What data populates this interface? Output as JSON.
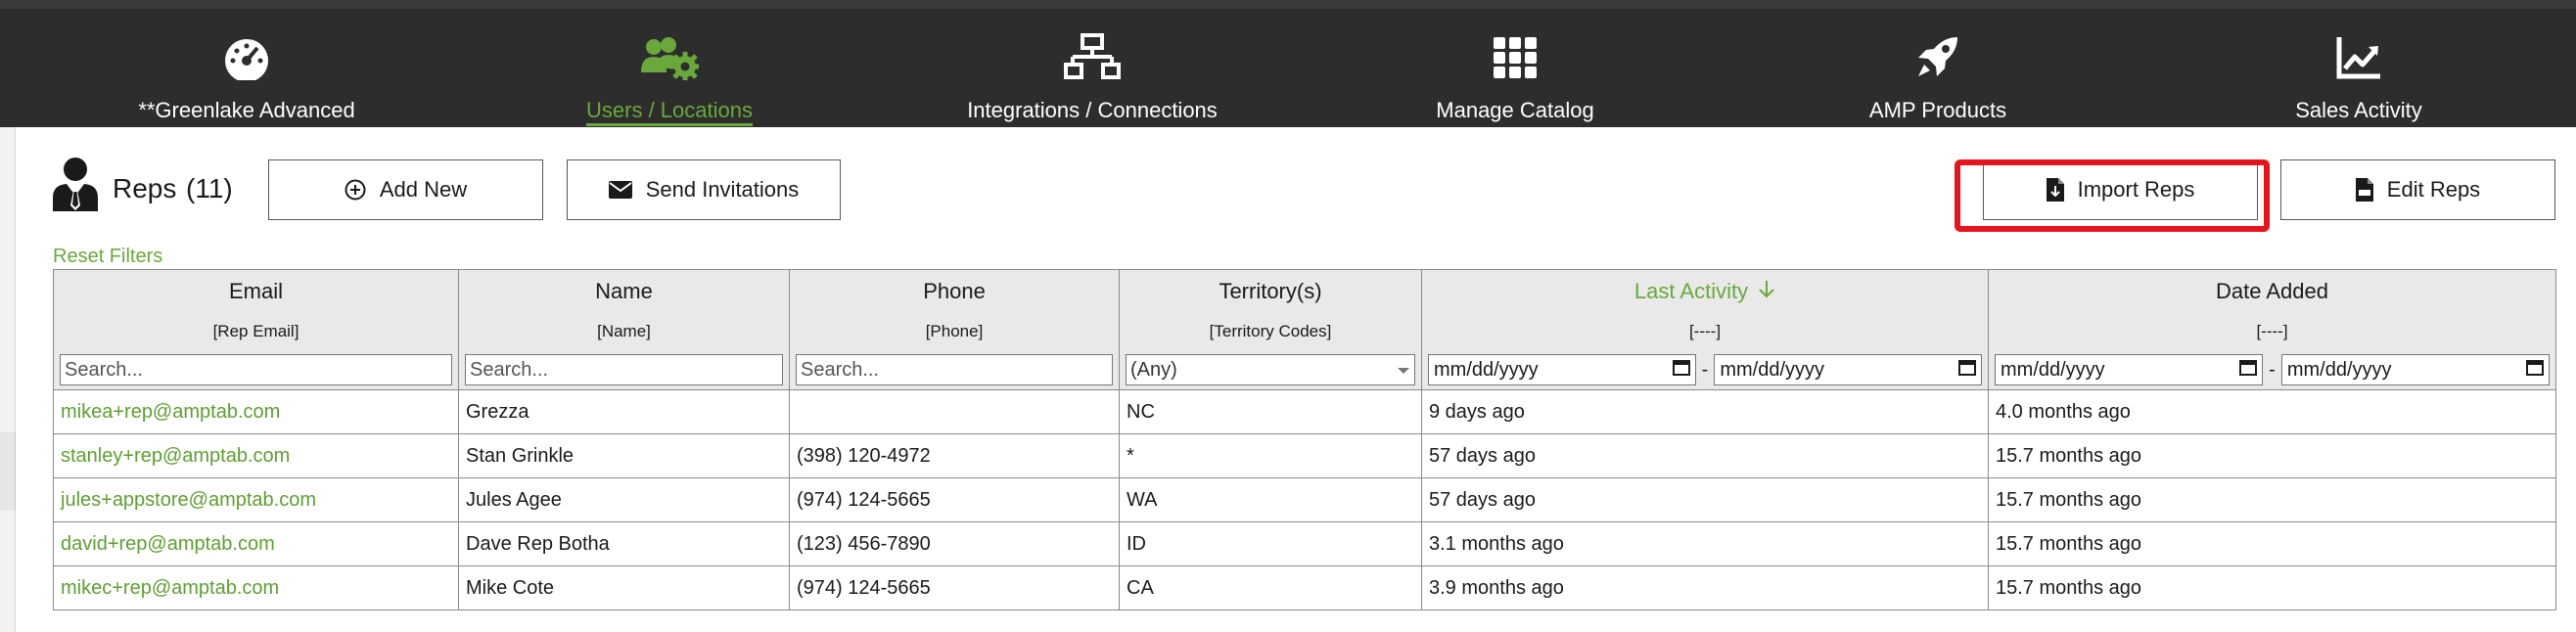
{
  "nav": {
    "items": [
      {
        "label": "**Greenlake Advanced",
        "icon": "dashboard-gauge-icon"
      },
      {
        "label": "Users / Locations",
        "icon": "users-gear-icon",
        "active": true
      },
      {
        "label": "Integrations / Connections",
        "icon": "network-icon"
      },
      {
        "label": "Manage Catalog",
        "icon": "grid-icon"
      },
      {
        "label": "AMP Products",
        "icon": "rocket-icon"
      },
      {
        "label": "Sales Activity",
        "icon": "chart-line-icon"
      }
    ],
    "active_color": "#6aa83b",
    "background": "#2d2d2d"
  },
  "header": {
    "title": "Reps",
    "count": "(11)",
    "add_new": "Add New",
    "send_invitations": "Send Invitations",
    "import_reps": "Import Reps",
    "edit_reps": "Edit Reps",
    "highlight_color": "#e8141b"
  },
  "reset_filters": "Reset Filters",
  "table": {
    "columns": [
      {
        "title": "Email",
        "sub": "[Rep Email]",
        "filter_placeholder": "Search..."
      },
      {
        "title": "Name",
        "sub": "[Name]",
        "filter_placeholder": "Search..."
      },
      {
        "title": "Phone",
        "sub": "[Phone]",
        "filter_placeholder": "Search..."
      },
      {
        "title": "Territory(s)",
        "sub": "[Territory Codes]",
        "filter_value": "(Any)"
      },
      {
        "title": "Last Activity",
        "sub": "[----]",
        "date_from": "mm/dd/yyyy",
        "date_to": "mm/dd/yyyy",
        "sort": "descending"
      },
      {
        "title": "Date Added",
        "sub": "[----]",
        "date_from": "mm/dd/yyyy",
        "date_to": "mm/dd/yyyy"
      }
    ],
    "date_separator": "-",
    "rows": [
      {
        "email": "mikea+rep@amptab.com",
        "name": "Grezza",
        "phone": "",
        "territory": "NC",
        "last_activity": "9 days ago",
        "date_added": "4.0 months ago"
      },
      {
        "email": "stanley+rep@amptab.com",
        "name": "Stan Grinkle",
        "phone": "(398) 120-4972",
        "territory": "*",
        "last_activity": "57 days ago",
        "date_added": "15.7 months ago"
      },
      {
        "email": "jules+appstore@amptab.com",
        "name": "Jules Agee",
        "phone": "(974) 124-5665",
        "territory": "WA",
        "last_activity": "57 days ago",
        "date_added": "15.7 months ago"
      },
      {
        "email": "david+rep@amptab.com",
        "name": "Dave Rep Botha",
        "phone": "(123) 456-7890",
        "territory": "ID",
        "last_activity": "3.1 months ago",
        "date_added": "15.7 months ago"
      },
      {
        "email": "mikec+rep@amptab.com",
        "name": "Mike Cote",
        "phone": "(974) 124-5665",
        "territory": "CA",
        "last_activity": "3.9 months ago",
        "date_added": "15.7 months ago"
      }
    ]
  }
}
